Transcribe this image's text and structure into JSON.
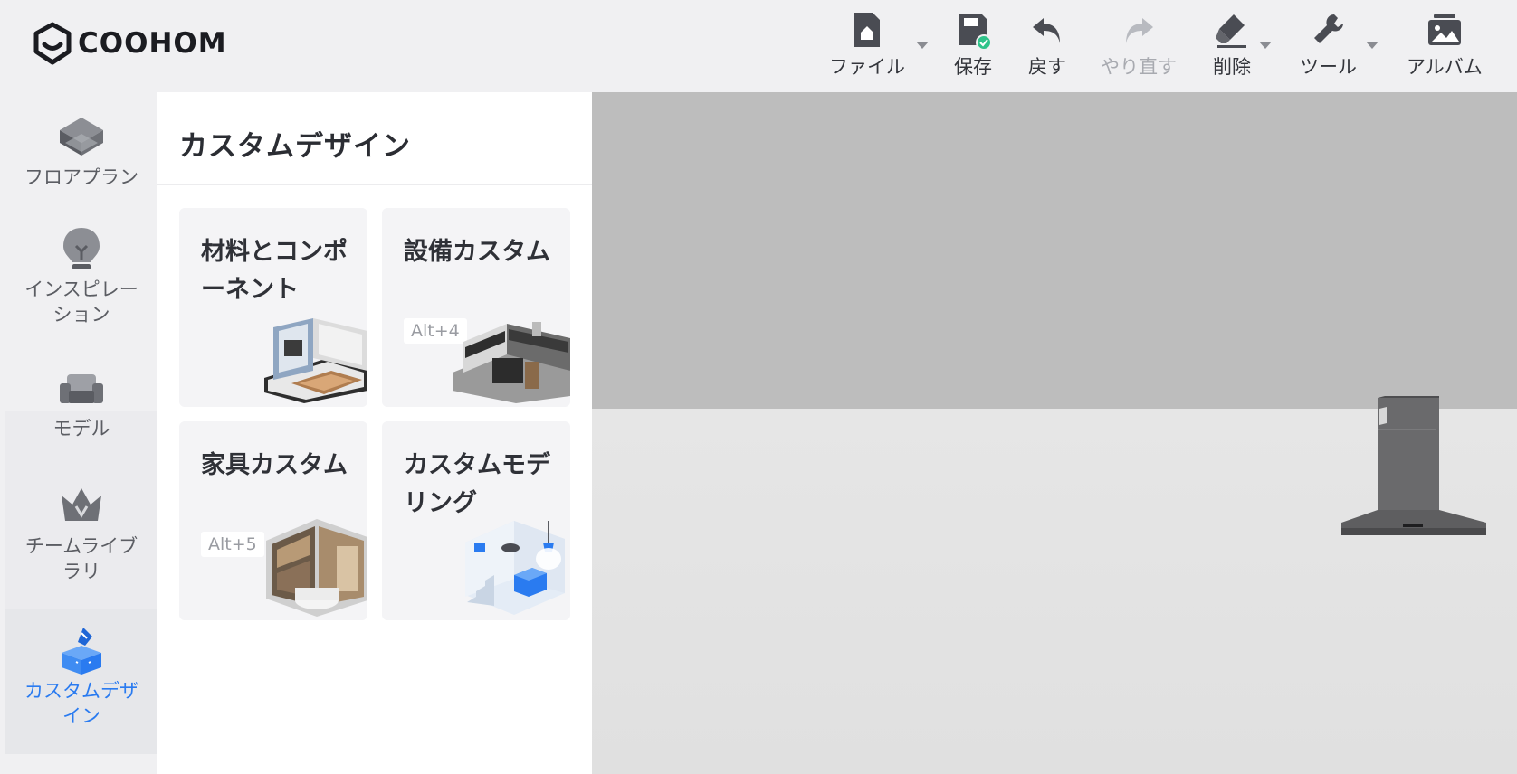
{
  "app": {
    "logo_text": "COOHOM",
    "brand_color": "#2a7bf0"
  },
  "toolbar": {
    "file": "ファイル",
    "save": "保存",
    "undo": "戻す",
    "redo": "やり直す",
    "delete": "削除",
    "tools": "ツール",
    "album": "アルバム"
  },
  "nav": {
    "floorplan": "フロアプラン",
    "inspiration": "インスピレーション",
    "model": "モデル",
    "team_library": "チームライブラリ",
    "custom_design": "カスタムデザイン"
  },
  "panel": {
    "title": "カスタムデザイン",
    "cards": [
      {
        "title": "材料とコンポーネント",
        "shortcut": ""
      },
      {
        "title": "設備カスタム",
        "shortcut": "Alt+4"
      },
      {
        "title": "家具カスタム",
        "shortcut": "Alt+5"
      },
      {
        "title": "カスタムモデリング",
        "shortcut": ""
      }
    ]
  }
}
